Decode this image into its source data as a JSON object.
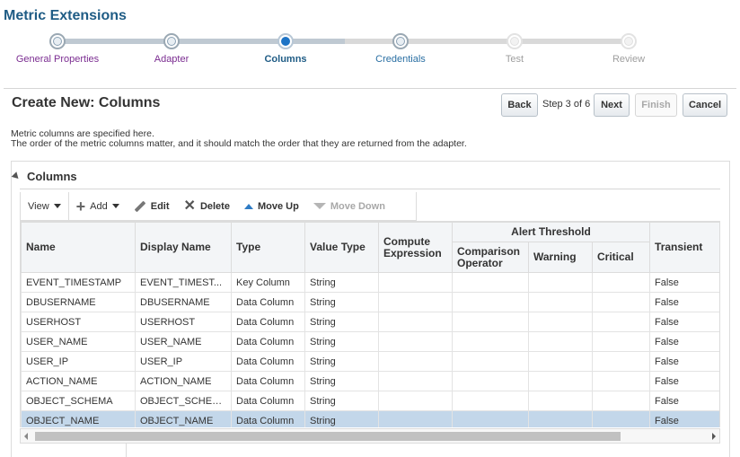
{
  "page_title": "Metric Extensions",
  "train": {
    "steps": [
      {
        "label": "General Properties",
        "state": "visited"
      },
      {
        "label": "Adapter",
        "state": "visited"
      },
      {
        "label": "Columns",
        "state": "current"
      },
      {
        "label": "Credentials",
        "state": "next"
      },
      {
        "label": "Test",
        "state": "future"
      },
      {
        "label": "Review",
        "state": "future"
      }
    ]
  },
  "section_title": "Create New: Columns",
  "nav": {
    "back_label": "Back",
    "step_text": "Step 3 of 6",
    "next_label": "Next",
    "finish_label": "Finish",
    "cancel_label": "Cancel"
  },
  "description": {
    "line1": "Metric columns are specified here.",
    "line2": "The order of the metric columns matter, and it should match the order that they are returned from the adapter."
  },
  "panel": {
    "title": "Columns",
    "toolbar": {
      "view_label": "View",
      "add_label": "Add",
      "edit_label": "Edit",
      "delete_label": "Delete",
      "move_up_label": "Move Up",
      "move_down_label": "Move Down"
    }
  },
  "table": {
    "headers": {
      "name": "Name",
      "display_name": "Display Name",
      "type": "Type",
      "value_type": "Value Type",
      "compute_expression": "Compute Expression",
      "alert_threshold": "Alert Threshold",
      "comparison_operator": "Comparison Operator",
      "warning": "Warning",
      "critical": "Critical",
      "transient": "Transient"
    },
    "rows": [
      {
        "name": "EVENT_TIMESTAMP",
        "display_name": "EVENT_TIMEST...",
        "type": "Key Column",
        "value_type": "String",
        "compute_expression": "",
        "comparison_operator": "",
        "warning": "",
        "critical": "",
        "transient": "False"
      },
      {
        "name": "DBUSERNAME",
        "display_name": "DBUSERNAME",
        "type": "Data Column",
        "value_type": "String",
        "compute_expression": "",
        "comparison_operator": "",
        "warning": "",
        "critical": "",
        "transient": "False"
      },
      {
        "name": "USERHOST",
        "display_name": "USERHOST",
        "type": "Data Column",
        "value_type": "String",
        "compute_expression": "",
        "comparison_operator": "",
        "warning": "",
        "critical": "",
        "transient": "False"
      },
      {
        "name": "USER_NAME",
        "display_name": "USER_NAME",
        "type": "Data Column",
        "value_type": "String",
        "compute_expression": "",
        "comparison_operator": "",
        "warning": "",
        "critical": "",
        "transient": "False"
      },
      {
        "name": "USER_IP",
        "display_name": "USER_IP",
        "type": "Data Column",
        "value_type": "String",
        "compute_expression": "",
        "comparison_operator": "",
        "warning": "",
        "critical": "",
        "transient": "False"
      },
      {
        "name": "ACTION_NAME",
        "display_name": "ACTION_NAME",
        "type": "Data Column",
        "value_type": "String",
        "compute_expression": "",
        "comparison_operator": "",
        "warning": "",
        "critical": "",
        "transient": "False"
      },
      {
        "name": "OBJECT_SCHEMA",
        "display_name": "OBJECT_SCHEMA",
        "type": "Data Column",
        "value_type": "String",
        "compute_expression": "",
        "comparison_operator": "",
        "warning": "",
        "critical": "",
        "transient": "False"
      },
      {
        "name": "OBJECT_NAME",
        "display_name": "OBJECT_NAME",
        "type": "Data Column",
        "value_type": "String",
        "compute_expression": "",
        "comparison_operator": "",
        "warning": "",
        "critical": "",
        "transient": "False"
      }
    ],
    "selected_row": 7
  }
}
